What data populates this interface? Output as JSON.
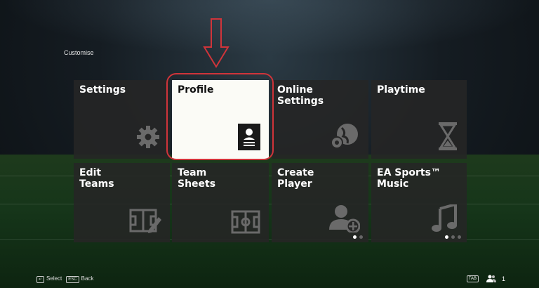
{
  "header": {
    "section_label": "Customise"
  },
  "tiles": [
    {
      "label": "Settings",
      "icon": "gear-icon"
    },
    {
      "label": "Profile",
      "icon": "id-card-icon",
      "selected": true
    },
    {
      "label": "Online\nSettings",
      "icon": "globe-gear-icon"
    },
    {
      "label": "Playtime",
      "icon": "hourglass-icon"
    },
    {
      "label": "Edit\nTeams",
      "icon": "formation-edit-icon"
    },
    {
      "label": "Team\nSheets",
      "icon": "pitch-icon"
    },
    {
      "label": "Create\nPlayer",
      "icon": "add-user-icon"
    },
    {
      "label": "EA Sports™\nMusic",
      "icon": "music-note-icon"
    }
  ],
  "footer": {
    "select_key": "↵",
    "select_label": "Select",
    "back_key": "ESC",
    "back_label": "Back",
    "tab_key": "TAB",
    "player_count": "1"
  },
  "colors": {
    "highlight": "#d0343a",
    "selected_tile": "#fbfbf6",
    "tile": "#262626"
  }
}
